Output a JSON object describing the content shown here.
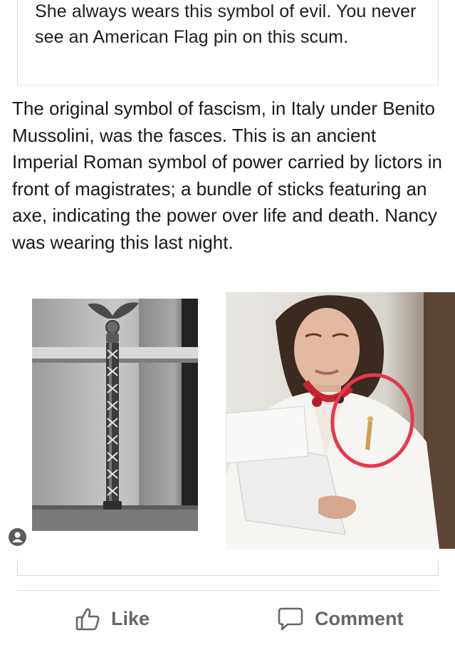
{
  "post": {
    "text": "She always wears this symbol of evil. You never see an American Flag pin on this scum."
  },
  "shared_post": {
    "text": "The original symbol of fascism, in Italy under Benito Mussolini, was the fasces. This is an ancient Imperial Roman symbol of power carried by lictors in front of magistrates; a bundle of sticks featuring an axe, indicating the power over life and death. Nancy was wearing this last night."
  },
  "icons": {
    "avatar": "person-icon",
    "like": "thumbs-up-icon",
    "comment": "speech-bubble-icon"
  },
  "actions": {
    "like_label": "Like",
    "comment_label": "Comment"
  },
  "colors": {
    "action_gray": "#65676b",
    "highlight_red": "#e8374c",
    "necklace_red": "#c8242f"
  }
}
